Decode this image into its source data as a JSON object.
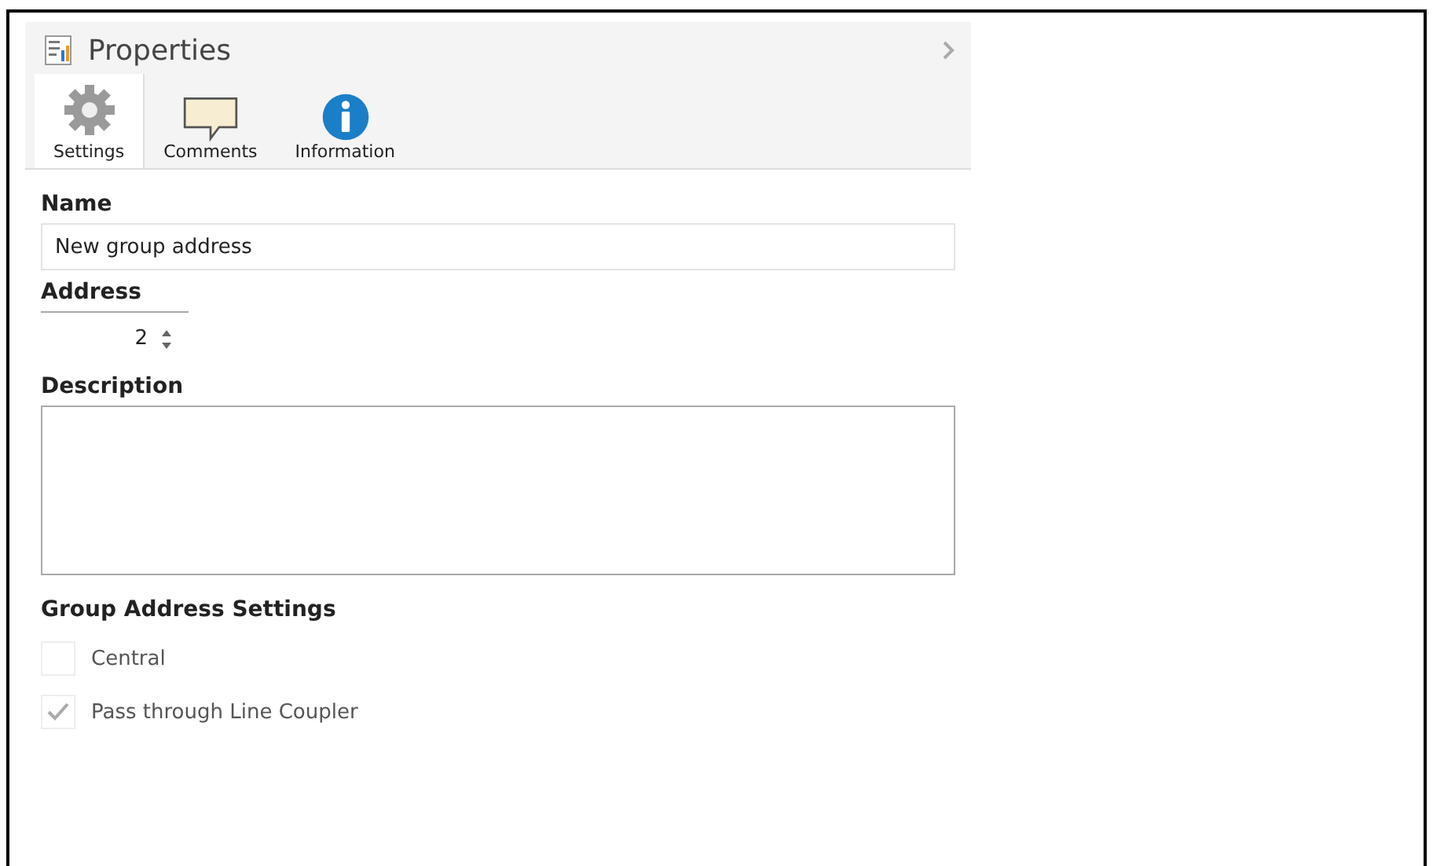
{
  "panel": {
    "title": "Properties"
  },
  "tabs": [
    {
      "label": "Settings",
      "kind": "gear",
      "selected": true
    },
    {
      "label": "Comments",
      "kind": "comment",
      "selected": false
    },
    {
      "label": "Information",
      "kind": "info",
      "selected": false
    }
  ],
  "name": {
    "label": "Name",
    "value": "New group address"
  },
  "address": {
    "label": "Address",
    "value": "2"
  },
  "description": {
    "label": "Description"
  },
  "group_settings": {
    "title": "Group Address Settings",
    "options": [
      {
        "label": "Central",
        "checked": false,
        "disabled": true
      },
      {
        "label": "Pass through Line Coupler",
        "checked": true,
        "disabled": true
      }
    ]
  }
}
